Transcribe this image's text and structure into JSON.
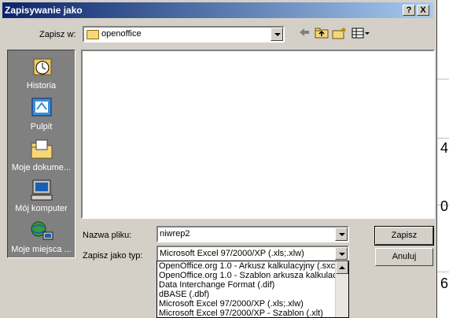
{
  "window": {
    "title": "Zapisywanie jako",
    "help_btn": "?",
    "close_btn": "X"
  },
  "save_in": {
    "label": "Zapisz w:",
    "value": "openoffice"
  },
  "places": [
    {
      "label": "Historia",
      "icon": "history-icon"
    },
    {
      "label": "Pulpit",
      "icon": "desktop-icon"
    },
    {
      "label": "Moje dokume...",
      "icon": "my-documents-icon"
    },
    {
      "label": "Mój komputer",
      "icon": "my-computer-icon"
    },
    {
      "label": "Moje miejsca ...",
      "icon": "network-places-icon"
    }
  ],
  "filename": {
    "label": "Nazwa pliku:",
    "value": "niwrep2"
  },
  "filetype": {
    "label": "Zapisz jako typ:",
    "value": "Microsoft Excel 97/2000/XP (.xls;.xlw)",
    "options": [
      "OpenOffice.org 1.0 - Arkusz kalkulacyjny (.sxc)",
      "OpenOffice.org 1.0 - Szablon arkusza kalkulacy",
      "Data Interchange Format (.dif)",
      "dBASE (.dbf)",
      "Microsoft Excel 97/2000/XP (.xls;.xlw)",
      "Microsoft Excel 97/2000/XP - Szablon (.xlt)"
    ]
  },
  "buttons": {
    "save": "Zapisz",
    "cancel": "Anuluj"
  },
  "background_digits": [
    "4",
    "0",
    "6"
  ],
  "colors": {
    "title_start": "#0a246a",
    "title_end": "#a6caf0",
    "face": "#d4d0c8",
    "places_bg": "#808080"
  }
}
